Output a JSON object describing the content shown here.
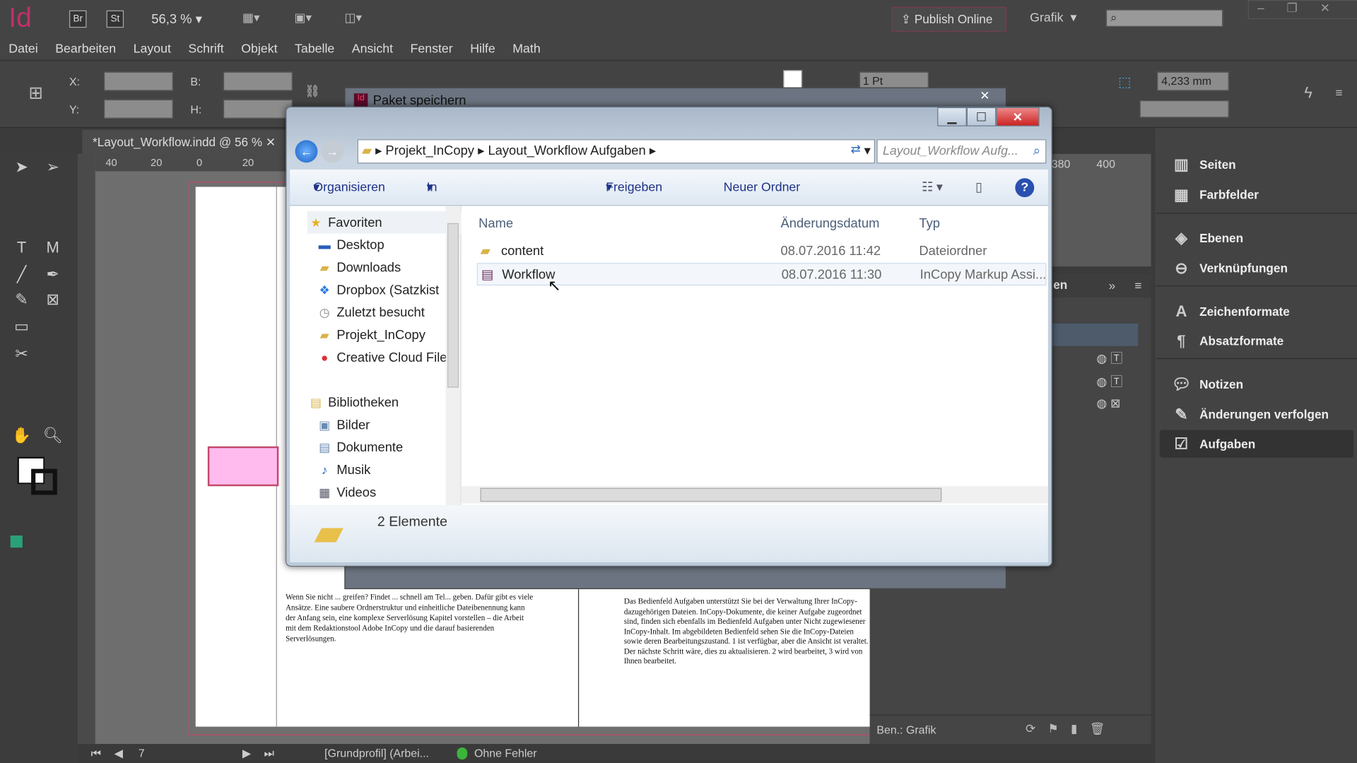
{
  "app": {
    "logo": "Id",
    "bridge": "Br",
    "stock": "St",
    "zoom": "56,3 %",
    "publish": "Publish Online",
    "workspace": "Grafik"
  },
  "menu": [
    "Datei",
    "Bearbeiten",
    "Layout",
    "Schrift",
    "Objekt",
    "Tabelle",
    "Ansicht",
    "Fenster",
    "Hilfe",
    "Math"
  ],
  "control": {
    "x_label": "X:",
    "y_label": "Y:",
    "b_label": "B:",
    "h_label": "H:",
    "stroke": "1 Pt",
    "size": "4,233 mm"
  },
  "document": {
    "tab": "*Layout_Workflow.indd @ 56 %",
    "ruler_ticks": [
      "40",
      "20",
      "0",
      "20"
    ],
    "ruler_right": [
      "380",
      "400"
    ],
    "text_left": "Wenn Sie nicht ... greifen? Findet ... schnell am Tel... geben. Dafür gibt es viele Ansätze. Eine saubere Ordnerstruktur und einheitliche Dateibenennung kann der Anfang sein, eine komplexe Serverlösung Kapitel vorstellen – die Arbeit mit dem Redaktionstool Adobe InCopy und die darauf basierenden Serverlösungen.",
    "text_right": "Das Bedienfeld Aufgaben unterstützt Sie bei der Verwaltung Ihrer InCopy-dazugehörigen Dateien. InCopy-Dokumente, die keiner Aufgabe zugeordnet sind, finden sich ebenfalls im Bedienfeld Aufgaben unter Nicht zugewiesener InCopy-Inhalt. Im abgebildeten Bedienfeld sehen Sie die InCopy-Dateien sowie deren Bearbeitungszustand. 1 ist verfügbar, aber die Ansicht ist veraltet. Der nächste Schritt wäre, dies zu aktualisieren. 2 wird bearbeitet, 3 wird von Ihnen bearbeitet."
  },
  "panel": {
    "items": [
      "Seiten",
      "Farbfelder",
      "Ebenen",
      "Verknüpfungen",
      "Zeichenformate",
      "Absatzformate",
      "Notizen",
      "Änderungen verfolgen",
      "Aufgaben"
    ],
    "tab_partial": "en",
    "footer": "Ben.: Grafik"
  },
  "status": {
    "page": "7",
    "profile": "[Grundprofil] (Arbei...",
    "errors": "Ohne Fehler",
    "ok_color": "#3cb43c"
  },
  "dialog_back": {
    "title": "Paket speichern"
  },
  "explorer": {
    "breadcrumb": [
      "Projekt_InCopy",
      "Layout_Workflow Aufgaben"
    ],
    "search_placeholder": "Layout_Workflow Aufg...",
    "toolbar": [
      "Organisieren",
      "In Bibliothek aufnehmen",
      "Freigeben für",
      "Neuer Ordner"
    ],
    "nav": [
      {
        "label": "Favoriten",
        "icon": "star-icon"
      },
      {
        "label": "Desktop",
        "icon": "desktop-icon"
      },
      {
        "label": "Downloads",
        "icon": "downloads-icon"
      },
      {
        "label": "Dropbox (Satzkist",
        "icon": "dropbox-icon"
      },
      {
        "label": "Zuletzt besucht",
        "icon": "recent-icon"
      },
      {
        "label": "Projekt_InCopy",
        "icon": "folder-icon"
      },
      {
        "label": "Creative Cloud File",
        "icon": "creative-cloud-icon"
      },
      {
        "label": "Bibliotheken",
        "icon": "library-icon"
      },
      {
        "label": "Bilder",
        "icon": "pictures-icon"
      },
      {
        "label": "Dokumente",
        "icon": "documents-icon"
      },
      {
        "label": "Musik",
        "icon": "music-icon"
      },
      {
        "label": "Videos",
        "icon": "videos-icon"
      }
    ],
    "columns": [
      "Name",
      "Änderungsdatum",
      "Typ"
    ],
    "files": [
      {
        "name": "content",
        "date": "08.07.2016 11:42",
        "type": "Dateiordner"
      },
      {
        "name": "Workflow",
        "date": "08.07.2016 11:30",
        "type": "InCopy Markup Assi..."
      }
    ],
    "count": "2 Elemente"
  }
}
